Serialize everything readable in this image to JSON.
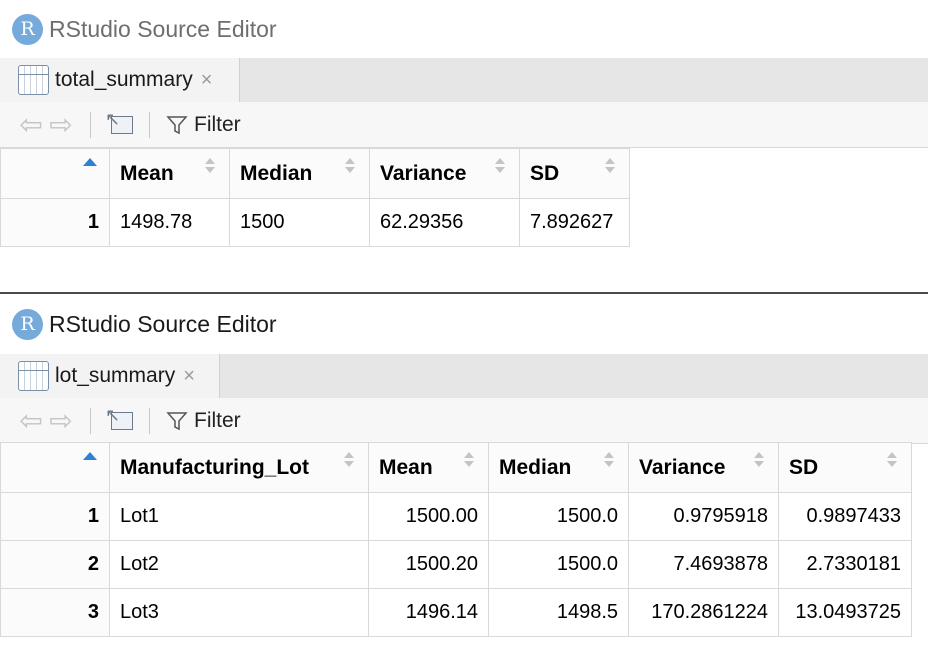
{
  "window1": {
    "title": "RStudio Source Editor",
    "logo_letter": "R",
    "tab": {
      "label": "total_summary",
      "close": "×"
    },
    "toolbar": {
      "back": "⇦",
      "forward": "⇨",
      "filter_label": "Filter"
    },
    "table": {
      "columns": [
        "Mean",
        "Median",
        "Variance",
        "SD"
      ],
      "rows": [
        {
          "index": "1",
          "cells": [
            "1498.78",
            "1500",
            "62.29356",
            "7.892627"
          ]
        }
      ]
    }
  },
  "window2": {
    "title": "RStudio Source Editor",
    "logo_letter": "R",
    "tab": {
      "label": "lot_summary",
      "close": "×"
    },
    "toolbar": {
      "back": "⇦",
      "forward": "⇨",
      "filter_label": "Filter"
    },
    "table": {
      "columns": [
        "Manufacturing_Lot",
        "Mean",
        "Median",
        "Variance",
        "SD"
      ],
      "rows": [
        {
          "index": "1",
          "cells": [
            "Lot1",
            "1500.00",
            "1500.0",
            "0.9795918",
            "0.9897433"
          ]
        },
        {
          "index": "2",
          "cells": [
            "Lot2",
            "1500.20",
            "1500.0",
            "7.4693878",
            "2.7330181"
          ]
        },
        {
          "index": "3",
          "cells": [
            "Lot3",
            "1496.14",
            "1498.5",
            "170.2861224",
            "13.0493725"
          ]
        }
      ]
    }
  },
  "colors": {
    "logo": "#75aadb",
    "sort_active": "#2f7fd3",
    "tabbar": "#e6e6e6"
  }
}
